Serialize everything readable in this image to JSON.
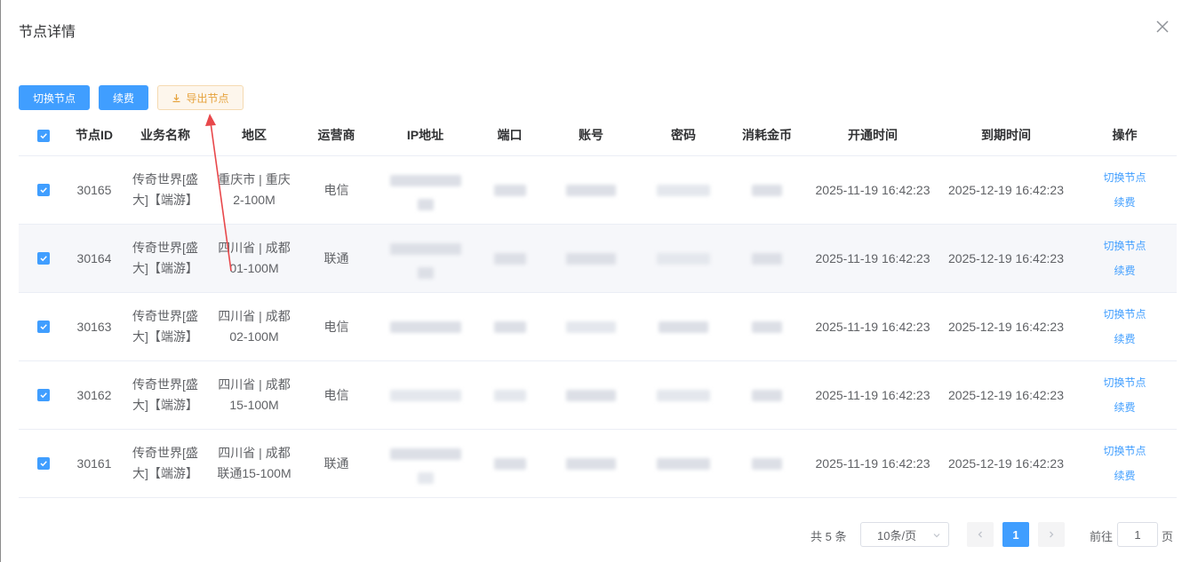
{
  "dialog": {
    "title": "节点详情"
  },
  "toolbar": {
    "switch_label": "切换节点",
    "renew_label": "续费",
    "export_label": "导出节点"
  },
  "table": {
    "headers": {
      "id": "节点ID",
      "biz": "业务名称",
      "region": "地区",
      "isp": "运营商",
      "ip": "IP地址",
      "port": "端口",
      "account": "账号",
      "password": "密码",
      "coins": "消耗金币",
      "open": "开通时间",
      "expire": "到期时间",
      "op": "操作"
    },
    "rows": [
      {
        "id": "30165",
        "biz1": "传奇世界[盛",
        "biz2": "大]【端游】",
        "region1": "重庆市 | 重庆",
        "region2": "2-100M",
        "isp": "电信",
        "open": "2025-11-19 16:42:23",
        "expire": "2025-12-19 16:42:23",
        "op_switch": "切换节点",
        "op_renew": "续费",
        "checked": true
      },
      {
        "id": "30164",
        "biz1": "传奇世界[盛",
        "biz2": "大]【端游】",
        "region1": "四川省 | 成都",
        "region2": "01-100M",
        "isp": "联通",
        "open": "2025-11-19 16:42:23",
        "expire": "2025-12-19 16:42:23",
        "op_switch": "切换节点",
        "op_renew": "续费",
        "checked": true
      },
      {
        "id": "30163",
        "biz1": "传奇世界[盛",
        "biz2": "大]【端游】",
        "region1": "四川省 | 成都",
        "region2": "02-100M",
        "isp": "电信",
        "open": "2025-11-19 16:42:23",
        "expire": "2025-12-19 16:42:23",
        "op_switch": "切换节点",
        "op_renew": "续费",
        "checked": true
      },
      {
        "id": "30162",
        "biz1": "传奇世界[盛",
        "biz2": "大]【端游】",
        "region1": "四川省 | 成都",
        "region2": "15-100M",
        "isp": "电信",
        "open": "2025-11-19 16:42:23",
        "expire": "2025-12-19 16:42:23",
        "op_switch": "切换节点",
        "op_renew": "续费",
        "checked": true
      },
      {
        "id": "30161",
        "biz1": "传奇世界[盛",
        "biz2": "大]【端游】",
        "region1": "四川省 | 成都",
        "region2": "联通15-100M",
        "isp": "联通",
        "open": "2025-11-19 16:42:23",
        "expire": "2025-12-19 16:42:23",
        "op_switch": "切换节点",
        "op_renew": "续费",
        "checked": true
      }
    ]
  },
  "pagination": {
    "total": "共 5 条",
    "page_size": "10条/页",
    "current": "1",
    "goto_prefix": "前往",
    "goto_value": "1",
    "goto_suffix": "页"
  },
  "colors": {
    "primary": "#409eff",
    "warning": "#e6a23c",
    "annotation_arrow": "#e8484b"
  },
  "icons": {
    "close": "close-icon",
    "download": "download-icon",
    "check": "check-icon",
    "chevron_down": "chevron-down-icon",
    "chevron_left": "chevron-left-icon",
    "chevron_right": "chevron-right-icon"
  }
}
